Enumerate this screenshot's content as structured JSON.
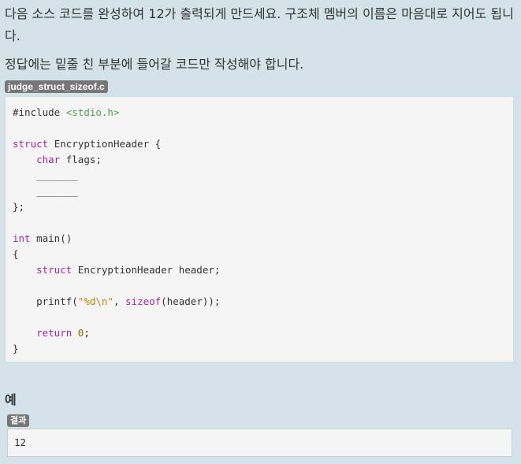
{
  "intro": {
    "line1": "다음 소스 코드를 완성하여 12가 출력되게 만드세요. 구조체 멤버의 이름은 마음대로 지어도 됩니다.",
    "line2": "정답에는 밑줄 친 부분에 들어갈 코드만 작성해야 합니다."
  },
  "file": {
    "name": "judge_struct_sizeof.c"
  },
  "code": {
    "include_kw": "#include",
    "include_hdr": "<stdio.h>",
    "struct_kw": "struct",
    "struct_name": "EncryptionHeader {",
    "char_kw": "char",
    "char_rest": "flags;",
    "blank1": "_______",
    "blank2": "_______",
    "close": "};",
    "int_kw": "int",
    "main_sig": "main()",
    "open_brace": "{",
    "struct_kw2": "struct",
    "decl_rest": "EncryptionHeader header;",
    "printf_name": "printf(",
    "printf_str": "\"%d\\n\"",
    "comma": ", ",
    "sizeof_kw": "sizeof",
    "sizeof_rest": "(header));",
    "return_kw": "return",
    "return_val": "0",
    "semicolon": ";",
    "close_brace": "}"
  },
  "example": {
    "title": "예",
    "result_label": "결과",
    "result_value": "12"
  },
  "colors": {
    "page_bg": "#d3e3e9",
    "keyword": "#a626a4",
    "string": "#50a14f",
    "badge_bg": "#777777"
  }
}
